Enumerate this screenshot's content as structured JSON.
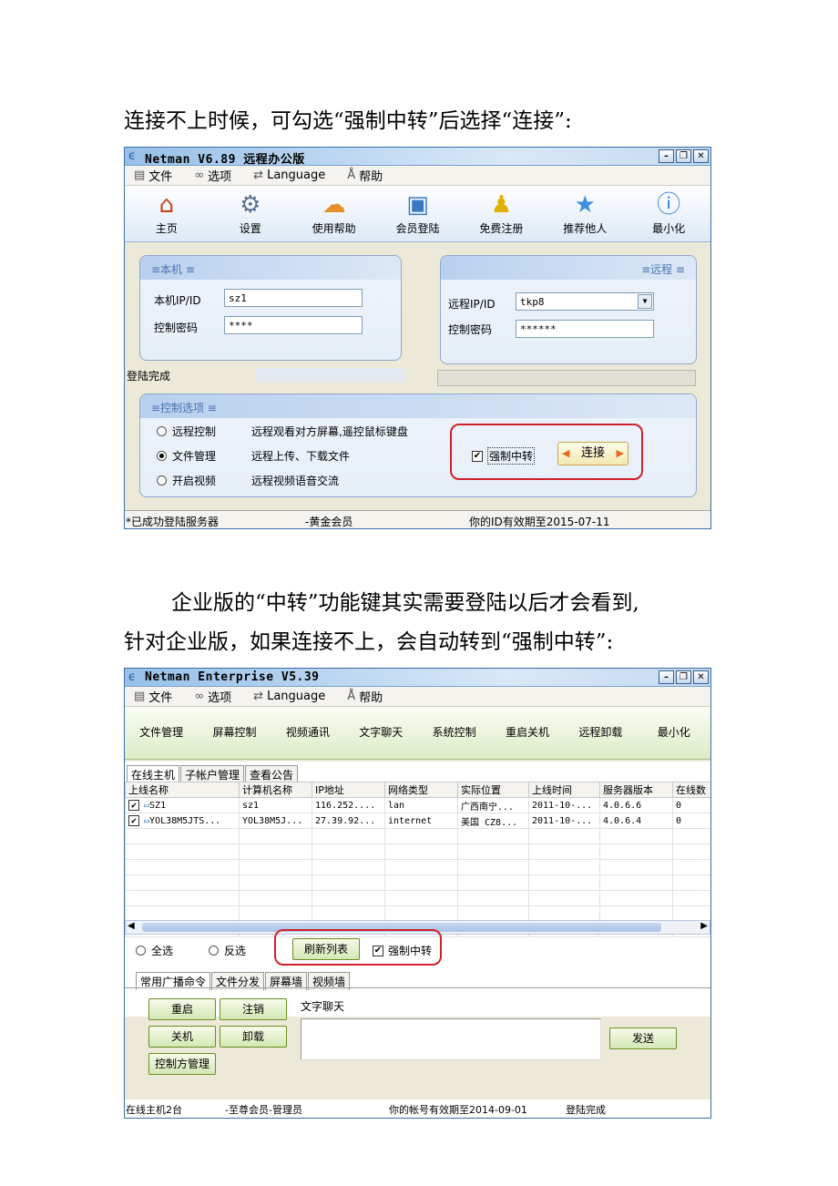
{
  "doc": {
    "para1": "连接不上时候，可勾选“强制中转”后选择“连接”:",
    "para2_line1": "企业版的“中转”功能键其实需要登陆以后才会看到,",
    "para2_line2": "针对企业版，如果连接不上，会自动转到“强制中转”:"
  },
  "win1": {
    "title": "Netman V6.89 远程办公版",
    "menu": [
      {
        "label": "文件",
        "icon": "file-icon"
      },
      {
        "label": "选项",
        "icon": "options-icon"
      },
      {
        "label": "Language",
        "icon": "language-icon"
      },
      {
        "label": "帮助",
        "icon": "help-icon"
      }
    ],
    "toolbar": [
      {
        "label": "主页",
        "icon": "home-icon",
        "glyph": "⌂"
      },
      {
        "label": "设置",
        "icon": "settings-icon",
        "glyph": "⚙"
      },
      {
        "label": "使用帮助",
        "icon": "help-chat-icon",
        "glyph": "☁"
      },
      {
        "label": "会员登陆",
        "icon": "member-login-icon",
        "glyph": "▣"
      },
      {
        "label": "免费注册",
        "icon": "register-icon",
        "glyph": "♟"
      },
      {
        "label": "推荐他人",
        "icon": "star-icon",
        "glyph": "★"
      },
      {
        "label": "最小化",
        "icon": "info-icon",
        "glyph": "ⓘ"
      }
    ],
    "local": {
      "header": "≡本机  ≡",
      "ip_label": "本机IP/ID",
      "ip_value": "sz1",
      "pwd_label": "控制密码",
      "pwd_value": "****"
    },
    "remote": {
      "header": "≡远程  ≡",
      "ip_label": "远程IP/ID",
      "ip_value": "tkp8",
      "pwd_label": "控制密码",
      "pwd_value": "******"
    },
    "login_status": "登陆完成",
    "options": {
      "header": "≡控制选项  ≡",
      "items": [
        {
          "label": "远程控制",
          "desc": "远程观看对方屏幕,遥控鼠标键盘",
          "checked": false
        },
        {
          "label": "文件管理",
          "desc": "远程上传、下载文件",
          "checked": true
        },
        {
          "label": "开启视频",
          "desc": "远程视频语音交流",
          "checked": false
        }
      ],
      "force_relay": "强制中转",
      "connect": "连接"
    },
    "status": {
      "left": "*已成功登陆服务器",
      "middle": "-黄金会员",
      "right": "你的ID有效期至2015-07-11"
    }
  },
  "win2": {
    "title": "Netman Enterprise V5.39",
    "menu": [
      {
        "label": "文件",
        "icon": "file-icon"
      },
      {
        "label": "选项",
        "icon": "options-icon"
      },
      {
        "label": "Language",
        "icon": "language-icon"
      },
      {
        "label": "帮助",
        "icon": "help-icon"
      }
    ],
    "toolbar": [
      "文件管理",
      "屏幕控制",
      "视频通讯",
      "文字聊天",
      "系统控制",
      "重启关机",
      "远程卸载",
      "最小化"
    ],
    "tabs": [
      "在线主机",
      "子帐户管理",
      "查看公告"
    ],
    "table": {
      "columns": [
        "上线名称",
        "计算机名称",
        "IP地址",
        "网络类型",
        "实际位置",
        "上线时间",
        "服务器版本",
        "在线数"
      ],
      "rows": [
        [
          "SZ1",
          "sz1",
          "116.252....",
          "lan",
          "广西南宁...",
          "2011-10-...",
          "4.0.6.6",
          "0"
        ],
        [
          "YOL38M5JTS...",
          "YOL38M5J...",
          "27.39.92...",
          "internet",
          "美国 CZ8...",
          "2011-10-...",
          "4.0.6.4",
          "0"
        ]
      ]
    },
    "select_all": "全选",
    "invert": "反选",
    "refresh": "刷新列表",
    "force_relay": "强制中转",
    "bottom_tabs": [
      "常用广播命令",
      "文件分发",
      "屏幕墙",
      "视频墙"
    ],
    "buttons": {
      "restart": "重启",
      "logout": "注销",
      "shutdown": "关机",
      "uninstall": "卸载",
      "controller": "控制方管理",
      "send": "发送"
    },
    "chat_label": "文字聊天",
    "status": {
      "left": "在线主机2台",
      "middle": "-至尊会员-管理员",
      "right": "你的帐号有效期至2014-09-01",
      "extra": "登陆完成"
    }
  }
}
